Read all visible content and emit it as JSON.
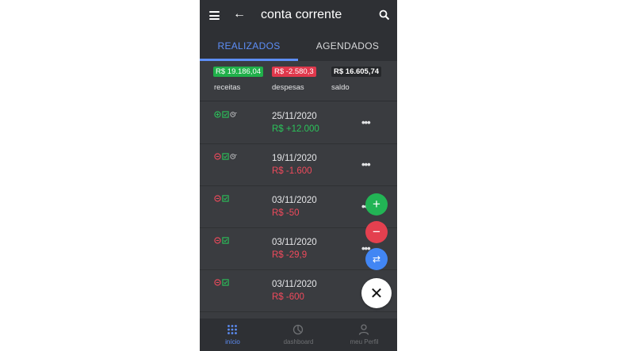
{
  "appbar": {
    "title": "conta corrente"
  },
  "tabs": [
    {
      "label": "REALIZADOS",
      "active": true
    },
    {
      "label": "AGENDADOS",
      "active": false
    }
  ],
  "summary": {
    "receitas": {
      "value": "R$ 19.186,04",
      "label": "receitas",
      "color": "#20b04a"
    },
    "despesas": {
      "value": "R$ -2.580,3",
      "label": "despesas",
      "color": "#e0384c"
    },
    "saldo": {
      "value": "R$ 16.605,74",
      "label": "saldo"
    }
  },
  "transactions": [
    {
      "date": "25/11/2020",
      "amount": "R$ +12.000",
      "type": "income",
      "icons": [
        "plus-circle-icon",
        "check-square-icon",
        "repeat-clock-icon"
      ]
    },
    {
      "date": "19/11/2020",
      "amount": "R$ -1.600",
      "type": "expense",
      "icons": [
        "minus-circle-icon",
        "check-square-icon",
        "repeat-clock-icon"
      ]
    },
    {
      "date": "03/11/2020",
      "amount": "R$ -50",
      "type": "expense",
      "icons": [
        "minus-circle-icon",
        "check-square-icon"
      ]
    },
    {
      "date": "03/11/2020",
      "amount": "R$ -29,9",
      "type": "expense",
      "icons": [
        "minus-circle-icon",
        "check-square-icon"
      ]
    },
    {
      "date": "03/11/2020",
      "amount": "R$ -600",
      "type": "expense",
      "icons": [
        "minus-circle-icon",
        "check-square-icon"
      ]
    }
  ],
  "more_label": "•••",
  "fabs": {
    "add": "+",
    "subtract": "−",
    "transfer": "⇄",
    "close": "✕"
  },
  "bottom_nav": [
    {
      "label": "início",
      "icon": "grid-dots-icon",
      "active": true
    },
    {
      "label": "dashboard",
      "icon": "pie-chart-icon",
      "active": false
    },
    {
      "label": "meu Perfil",
      "icon": "user-icon",
      "active": false
    }
  ],
  "colors": {
    "accent": "#5d8ef7",
    "income": "#2bc25a",
    "expense": "#ef4a5c",
    "background": "#3a3c40"
  }
}
